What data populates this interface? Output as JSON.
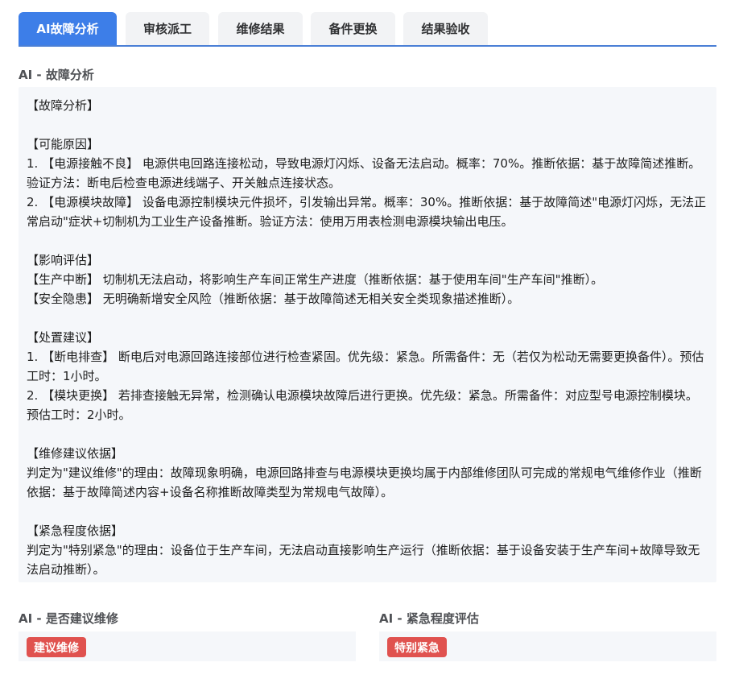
{
  "tabs": [
    {
      "label": "AI故障分析",
      "active": true
    },
    {
      "label": "审核派工",
      "active": false
    },
    {
      "label": "维修结果",
      "active": false
    },
    {
      "label": "备件更换",
      "active": false
    },
    {
      "label": "结果验收",
      "active": false
    }
  ],
  "analysis": {
    "label": "AI - 故障分析",
    "text": "【故障分析】\n\n【可能原因】\n1. 【电源接触不良】 电源供电回路连接松动，导致电源灯闪烁、设备无法启动。概率：70%。推断依据：基于故障简述推断。验证方法：断电后检查电源进线端子、开关触点连接状态。\n2. 【电源模块故障】 设备电源控制模块元件损坏，引发输出异常。概率：30%。推断依据：基于故障简述\"电源灯闪烁，无法正常启动\"症状+切制机为工业生产设备推断。验证方法：使用万用表检测电源模块输出电压。\n\n【影响评估】\n【生产中断】 切制机无法启动，将影响生产车间正常生产进度（推断依据：基于使用车间\"生产车间\"推断）。\n【安全隐患】 无明确新增安全风险（推断依据：基于故障简述无相关安全类现象描述推断）。\n\n【处置建议】\n1. 【断电排查】 断电后对电源回路连接部位进行检查紧固。优先级：紧急。所需备件：无（若仅为松动无需要更换备件）。预估工时：1小时。\n2. 【模块更换】 若排查接触无异常，检测确认电源模块故障后进行更换。优先级：紧急。所需备件：对应型号电源控制模块。预估工时：2小时。\n\n【维修建议依据】\n判定为\"建议维修\"的理由：故障现象明确，电源回路排查与电源模块更换均属于内部维修团队可完成的常规电气维修作业（推断依据：基于故障简述内容+设备名称推断故障类型为常规电气故障）。\n\n【紧急程度依据】\n判定为\"特别紧急\"的理由：设备位于生产车间，无法启动直接影响生产运行（推断依据：基于设备安装于生产车间+故障导致无法启动推断）。"
  },
  "repair": {
    "label": "AI - 是否建议维修",
    "badge": "建议维修"
  },
  "urgency": {
    "label": "AI - 紧急程度评估",
    "badge": "特别紧急"
  },
  "colors": {
    "accent": "#3d7ee8",
    "badge_red": "#e0524f",
    "panel_bg": "#f5f7fa"
  }
}
